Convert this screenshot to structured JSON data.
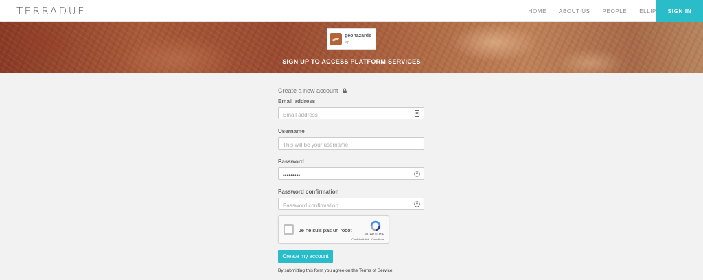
{
  "brand": {
    "logo_text": "TERRADUE"
  },
  "nav": {
    "items": [
      "HOME",
      "ABOUT US",
      "PEOPLE",
      "ELLIP"
    ],
    "signin_label": "SIGN IN"
  },
  "banner": {
    "badge_title": "geohazards",
    "badge_sub": "tep",
    "title": "SIGN UP TO ACCESS PLATFORM SERVICES"
  },
  "form": {
    "heading": "Create a new account",
    "email": {
      "label": "Email address",
      "placeholder": "Email address"
    },
    "username": {
      "label": "Username",
      "placeholder": "This will be your username"
    },
    "password": {
      "label": "Password",
      "value": "•••••••••"
    },
    "password_confirm": {
      "label": "Password confirmation",
      "placeholder": "Password confirmation"
    },
    "captcha": {
      "text": "Je ne suis pas un robot",
      "brand": "reCAPTCHA",
      "links": "Confidentialité - Conditions"
    },
    "submit_label": "Create my account",
    "terms_prefix": "By submitting this form you agree on the ",
    "terms_link": "Terms of Service",
    "terms_suffix": "."
  },
  "colors": {
    "accent": "#2bbcc9",
    "background": "#f2f2f2"
  },
  "icons": [
    "lock-icon",
    "contact-card-icon",
    "key-icon",
    "recaptcha-icon"
  ]
}
